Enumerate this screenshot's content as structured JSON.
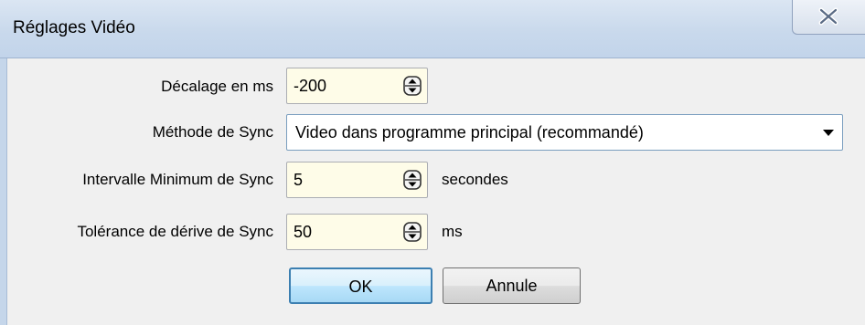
{
  "window": {
    "title": "Réglages Vidéo",
    "close_icon": "close-icon"
  },
  "form": {
    "offset": {
      "label": "Décalage en ms",
      "value": "-200",
      "unit": ""
    },
    "sync_method": {
      "label": "Méthode de Sync",
      "selected": "Video dans programme principal (recommandé)"
    },
    "min_interval": {
      "label": "Intervalle Minimum de Sync",
      "value": "5",
      "unit": "secondes"
    },
    "drift_tolerance": {
      "label": "Tolérance de dérive de Sync",
      "value": "50",
      "unit": "ms"
    }
  },
  "buttons": {
    "ok": "OK",
    "cancel": "Annule"
  },
  "colors": {
    "field_background": "#fefce8",
    "titlebar": "#c9d9ec",
    "ok_border": "#3c7fb1"
  }
}
